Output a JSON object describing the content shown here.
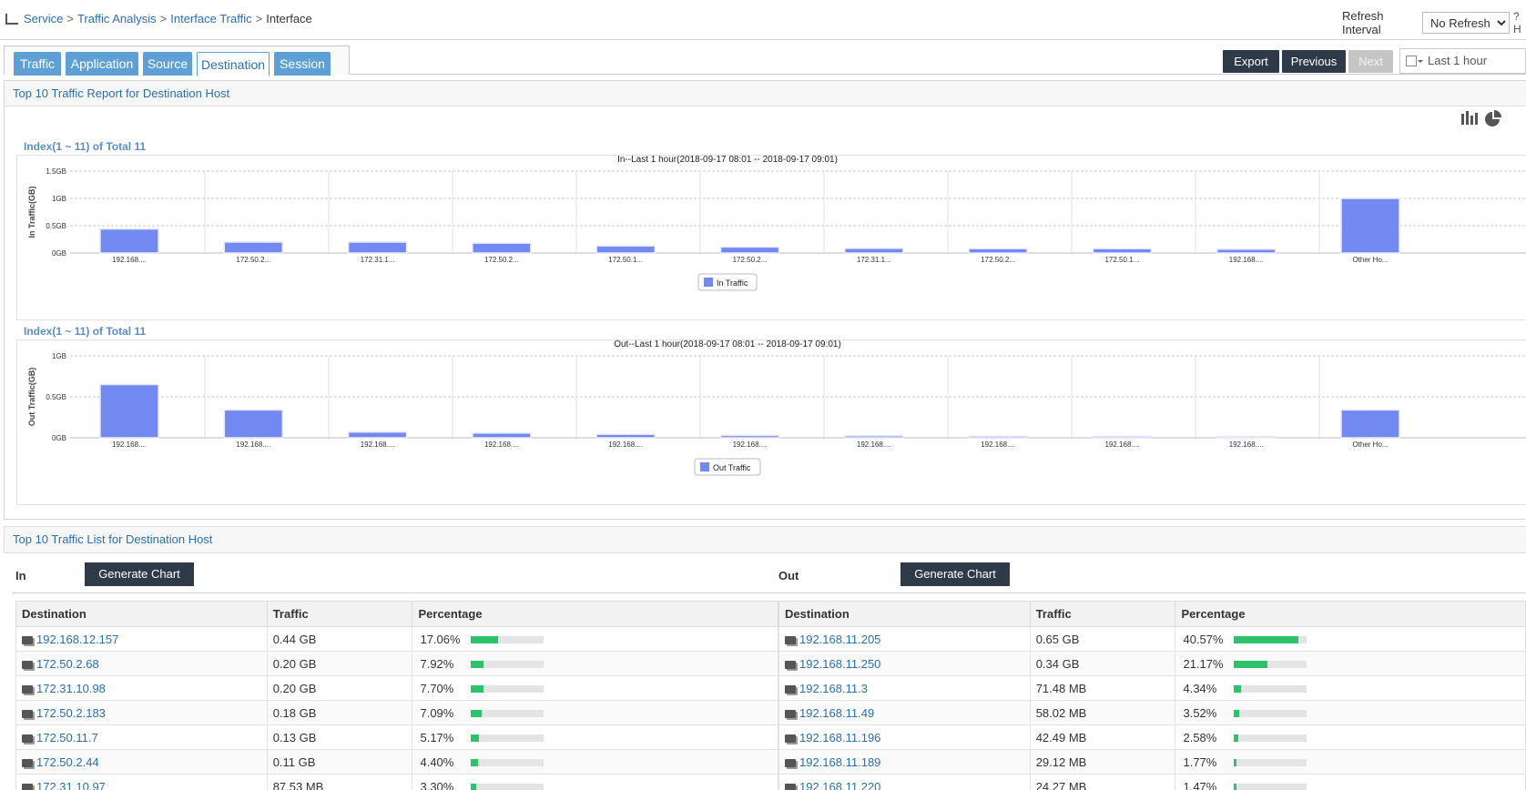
{
  "breadcrumb": [
    "Service",
    "Traffic Analysis",
    "Interface Traffic",
    "Interface"
  ],
  "breadcrumb_sep": ">",
  "refresh": {
    "label": "Refresh Interval",
    "value": "No Refresh",
    "help": "?H"
  },
  "tabs": [
    "Traffic",
    "Application",
    "Source",
    "Destination",
    "Session"
  ],
  "active_tab": "Destination",
  "toolbar": {
    "export": "Export",
    "previous": "Previous",
    "next": "Next",
    "time_range": "Last 1 hour"
  },
  "report": {
    "title": "Top 10 Traffic Report for Destination Host",
    "index_in": "Index(1 ~ 11) of Total 11",
    "index_out": "Index(1 ~ 11) of Total 11"
  },
  "chart_data": [
    {
      "type": "bar",
      "title": "In--Last 1 hour(2018-09-17 08:01 -- 2018-09-17 09:01)",
      "ylabel": "In Traffic(GB)",
      "yticks": [
        "0GB",
        "0.5GB",
        "1GB",
        "1.5GB"
      ],
      "ylim": [
        0,
        1.5
      ],
      "categories": [
        "192.168....",
        "172.50.2...",
        "172.31.1...",
        "172.50.2...",
        "172.50.1...",
        "172.50.2...",
        "172.31.1...",
        "172.50.2...",
        "172.50.1...",
        "192.168....",
        "Other Ho..."
      ],
      "series": [
        {
          "name": "In Traffic",
          "values": [
            0.44,
            0.2,
            0.2,
            0.18,
            0.13,
            0.11,
            0.085,
            0.08,
            0.08,
            0.07,
            1.0
          ]
        }
      ],
      "color": "#7389f2",
      "legend": "bottom-center",
      "grid": true
    },
    {
      "type": "bar",
      "title": "Out--Last 1 hour(2018-09-17 08:01 -- 2018-09-17 09:01)",
      "ylabel": "Out Traffic(GB)",
      "yticks": [
        "0GB",
        "0.5GB",
        "1GB"
      ],
      "ylim": [
        0,
        1.0
      ],
      "categories": [
        "192.168....",
        "192.168....",
        "192.168....",
        "192.168....",
        "192.168....",
        "192.168....",
        "192.168....",
        "192.168....",
        "192.168....",
        "192.168....",
        "Other Ho..."
      ],
      "series": [
        {
          "name": "Out Traffic",
          "values": [
            0.65,
            0.34,
            0.07,
            0.057,
            0.042,
            0.029,
            0.024,
            0.02,
            0.018,
            0.016,
            0.34
          ]
        }
      ],
      "color": "#7389f2",
      "legend": "bottom-center",
      "grid": true
    }
  ],
  "list": {
    "title": "Top 10 Traffic List for Destination Host",
    "in_label": "In",
    "out_label": "Out",
    "generate_chart": "Generate Chart",
    "columns": [
      "Destination",
      "Traffic",
      "Percentage"
    ],
    "in_rows": [
      {
        "dest": "192.168.12.157",
        "traffic": "0.44 GB",
        "pct": "17.06%",
        "frac": 0.1706
      },
      {
        "dest": "172.50.2.68",
        "traffic": "0.20 GB",
        "pct": "7.92%",
        "frac": 0.0792
      },
      {
        "dest": "172.31.10.98",
        "traffic": "0.20 GB",
        "pct": "7.70%",
        "frac": 0.077
      },
      {
        "dest": "172.50.2.183",
        "traffic": "0.18 GB",
        "pct": "7.09%",
        "frac": 0.0709
      },
      {
        "dest": "172.50.11.7",
        "traffic": "0.13 GB",
        "pct": "5.17%",
        "frac": 0.0517
      },
      {
        "dest": "172.50.2.44",
        "traffic": "0.11 GB",
        "pct": "4.40%",
        "frac": 0.044
      },
      {
        "dest": "172.31.10.97",
        "traffic": "87.53 MB",
        "pct": "3.30%",
        "frac": 0.033
      }
    ],
    "out_rows": [
      {
        "dest": "192.168.11.205",
        "traffic": "0.65 GB",
        "pct": "40.57%",
        "frac": 0.4057
      },
      {
        "dest": "192.168.11.250",
        "traffic": "0.34 GB",
        "pct": "21.17%",
        "frac": 0.2117
      },
      {
        "dest": "192.168.11.3",
        "traffic": "71.48 MB",
        "pct": "4.34%",
        "frac": 0.0434
      },
      {
        "dest": "192.168.11.49",
        "traffic": "58.02 MB",
        "pct": "3.52%",
        "frac": 0.0352
      },
      {
        "dest": "192.168.11.196",
        "traffic": "42.49 MB",
        "pct": "2.58%",
        "frac": 0.0258
      },
      {
        "dest": "192.168.11.189",
        "traffic": "29.12 MB",
        "pct": "1.77%",
        "frac": 0.0177
      },
      {
        "dest": "192.168.11.220",
        "traffic": "24.27 MB",
        "pct": "1.47%",
        "frac": 0.0147
      }
    ]
  }
}
